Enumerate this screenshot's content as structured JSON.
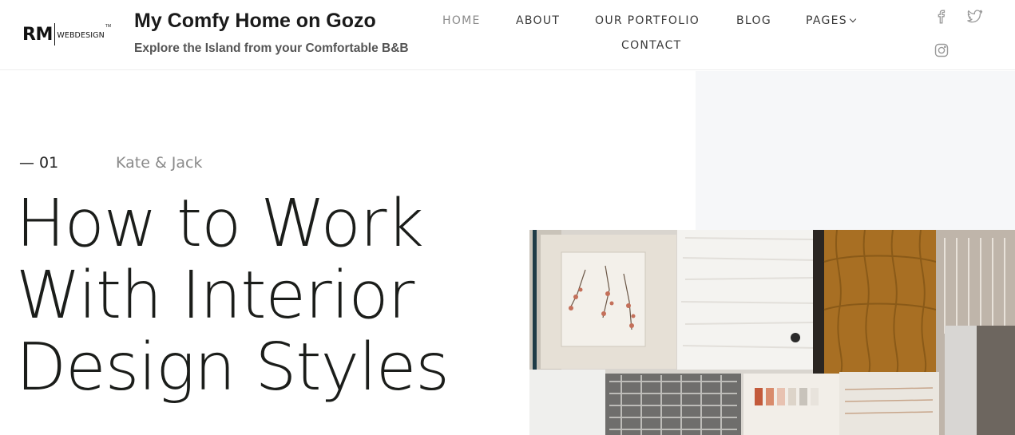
{
  "logo": {
    "mark": "RM",
    "sub": "WEBDESIGN",
    "tm": "TM"
  },
  "site": {
    "title": "My Comfy Home on Gozo",
    "tagline": "Explore the Island from your Comfortable B&B"
  },
  "nav": {
    "home": "HOME",
    "about": "ABOUT",
    "portfolio": "OUR PORTFOLIO",
    "blog": "BLOG",
    "pages": "PAGES",
    "contact": "CONTACT",
    "active_color": "#8a8a8a"
  },
  "social": {
    "facebook_icon": "facebook-icon",
    "twitter_icon": "twitter-icon",
    "instagram_icon": "instagram-icon"
  },
  "post": {
    "number": "— 01",
    "author": "Kate & Jack",
    "title_lines": [
      "How to Work",
      "With Interior",
      "Design Styles"
    ],
    "image": "fabric-swatches-image"
  },
  "colors": {
    "panel": "#f6f7f9",
    "heading": "#1b1d1a"
  }
}
